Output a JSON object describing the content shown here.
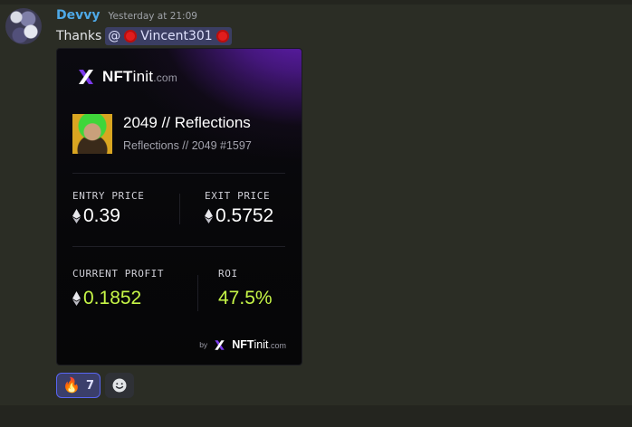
{
  "message": {
    "username": "Devvy",
    "timestamp": "Yesterday at 21:09",
    "text": "Thanks",
    "mention": "@⁠",
    "mention_name": "Vincent301"
  },
  "card": {
    "brand": {
      "name_bold": "NFT",
      "name_thin": "init",
      "name_suffix": ".com"
    },
    "nft": {
      "title": "2049 // Reflections",
      "subtitle": "Reflections // 2049 #1597"
    },
    "entry": {
      "label": "ENTRY PRICE",
      "value": "0.39"
    },
    "exit": {
      "label": "EXIT PRICE",
      "value": "0.5752"
    },
    "profit": {
      "label": "CURRENT PROFIT",
      "value": "0.1852"
    },
    "roi": {
      "label": "ROI",
      "value": "47.5%"
    },
    "footer": {
      "by": "by",
      "name_bold": "NFT",
      "name_thin": "init",
      "name_suffix": ".com"
    }
  },
  "reactions": [
    {
      "icon": "fire-icon",
      "emoji": "🔥",
      "count": "7"
    }
  ],
  "colors": {
    "accent_purple": "#6a1fc2",
    "profit_green": "#c6f547",
    "username_blue": "#4ea9e8",
    "mention_bg": "#3b3e63"
  }
}
